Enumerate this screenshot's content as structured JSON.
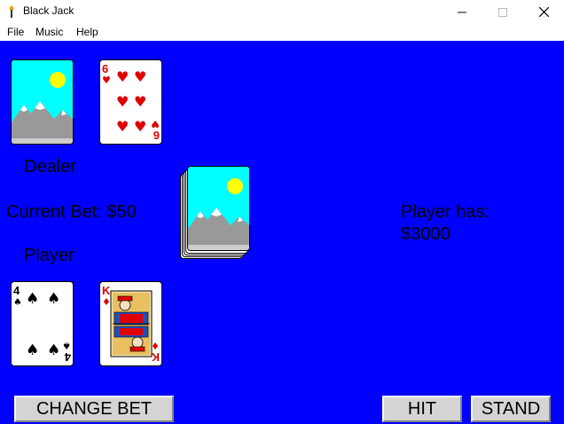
{
  "window": {
    "title": "Black Jack",
    "icons": {
      "app": "torch-icon",
      "minimize": "minimize-icon",
      "maximize": "maximize-icon",
      "close": "close-icon"
    }
  },
  "menu": {
    "items": [
      "File",
      "Music",
      "Help"
    ]
  },
  "table": {
    "background": "#0000ff",
    "dealer_label": "Dealer",
    "player_label": "Player",
    "current_bet": "Current Bet: $50",
    "player_has_line1": "Player has:",
    "player_has_line2": "$3000",
    "dealer_cards": [
      {
        "face": "down",
        "design": "sky-mountain"
      },
      {
        "face": "up",
        "rank": "6",
        "suit": "hearts"
      }
    ],
    "player_cards": [
      {
        "face": "up",
        "rank": "4",
        "suit": "spades"
      },
      {
        "face": "up",
        "rank": "K",
        "suit": "diamonds"
      }
    ],
    "deck": {
      "design": "sky-mountain"
    }
  },
  "buttons": {
    "change_bet": "CHANGE BET",
    "hit": "HIT",
    "stand": "STAND"
  }
}
